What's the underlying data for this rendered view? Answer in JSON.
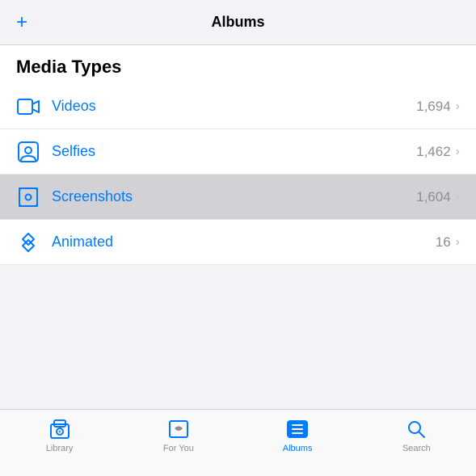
{
  "nav": {
    "title": "Albums",
    "add_label": "+"
  },
  "section": {
    "header": "Media Types"
  },
  "items": [
    {
      "id": "videos",
      "label": "Videos",
      "count": "1,694",
      "selected": false
    },
    {
      "id": "selfies",
      "label": "Selfies",
      "count": "1,462",
      "selected": false
    },
    {
      "id": "screenshots",
      "label": "Screenshots",
      "count": "1,604",
      "selected": true
    },
    {
      "id": "animated",
      "label": "Animated",
      "count": "16",
      "selected": false
    }
  ],
  "tabs": [
    {
      "id": "library",
      "label": "Library",
      "active": false
    },
    {
      "id": "for-you",
      "label": "For You",
      "active": false
    },
    {
      "id": "albums",
      "label": "Albums",
      "active": true
    },
    {
      "id": "search",
      "label": "Search",
      "active": false
    }
  ],
  "chevron": "›"
}
